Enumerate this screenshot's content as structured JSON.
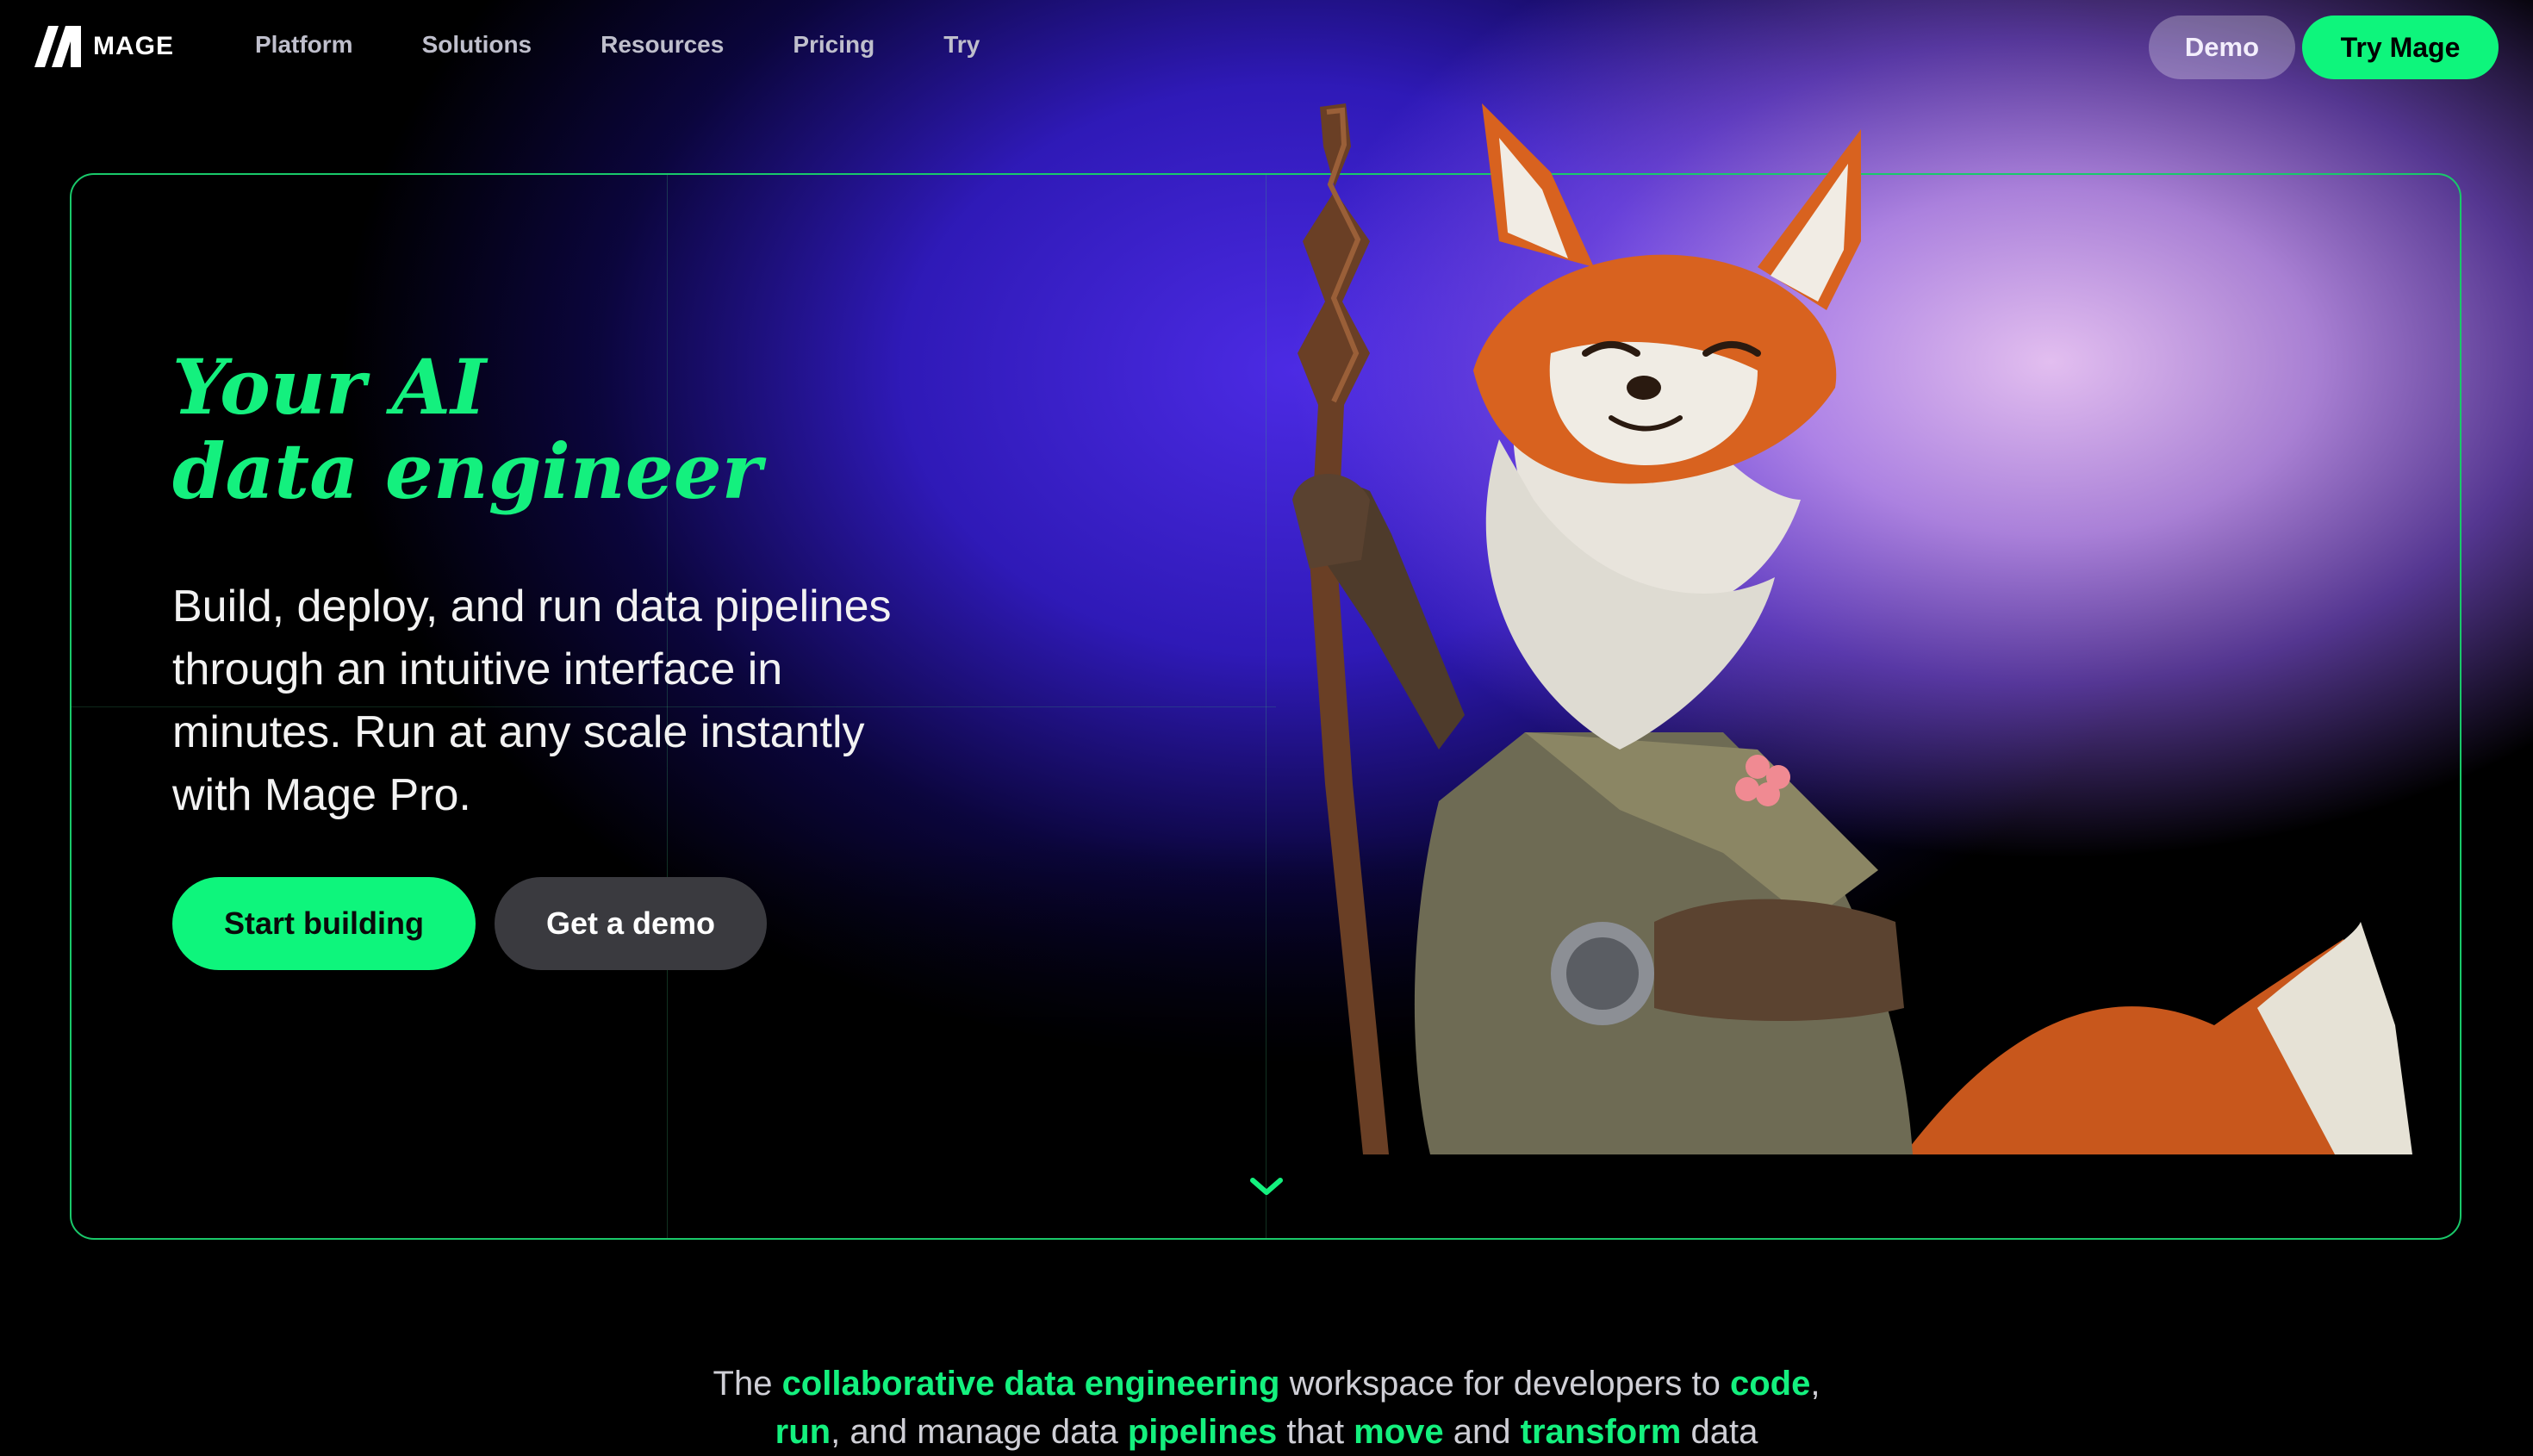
{
  "nav": {
    "logo_text": "MAGE",
    "links": [
      "Platform",
      "Solutions",
      "Resources",
      "Pricing",
      "Try"
    ],
    "demo_label": "Demo",
    "try_label": "Try Mage"
  },
  "hero": {
    "headline_line1": "Your AI",
    "headline_line2": "data engineer",
    "subheadline": "Build, deploy, and run data pipelines through an intuitive interface in minutes. Run at any scale instantly with Mage Pro.",
    "start_label": "Start building",
    "demo_label": "Get a demo"
  },
  "tagline": {
    "parts": [
      {
        "text": "The ",
        "hl": false
      },
      {
        "text": "collaborative data engineering",
        "hl": true
      },
      {
        "text": " workspace for developers to ",
        "hl": false
      },
      {
        "text": "code",
        "hl": true
      },
      {
        "text": ",",
        "hl": false
      },
      {
        "text": "run",
        "hl": true
      },
      {
        "text": ", and manage data ",
        "hl": false
      },
      {
        "text": "pipelines",
        "hl": true
      },
      {
        "text": " that ",
        "hl": false
      },
      {
        "text": "move",
        "hl": true
      },
      {
        "text": " and ",
        "hl": false
      },
      {
        "text": "transform",
        "hl": true
      },
      {
        "text": " data",
        "hl": false
      }
    ]
  },
  "colors": {
    "accent": "#0ef57c",
    "background": "#000000",
    "glow_purple": "#5a34f0",
    "glow_pink": "#eec8fa"
  },
  "icons": {
    "logo": "mage-logo-icon",
    "scroll": "chevron-down-icon"
  }
}
